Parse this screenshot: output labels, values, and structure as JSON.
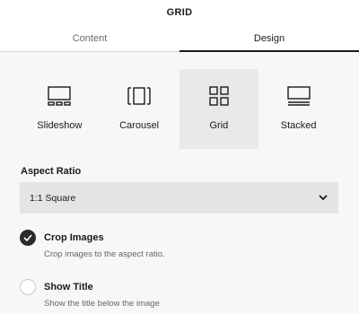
{
  "panel": {
    "title": "GRID"
  },
  "tabs": [
    {
      "label": "Content",
      "active": false
    },
    {
      "label": "Design",
      "active": true
    }
  ],
  "layouts": [
    {
      "label": "Slideshow",
      "icon": "slideshow-icon",
      "selected": false
    },
    {
      "label": "Carousel",
      "icon": "carousel-icon",
      "selected": false
    },
    {
      "label": "Grid",
      "icon": "grid-icon",
      "selected": true
    },
    {
      "label": "Stacked",
      "icon": "stacked-icon",
      "selected": false
    }
  ],
  "aspect_ratio": {
    "label": "Aspect Ratio",
    "value": "1:1 Square",
    "icon": "chevron-down-icon"
  },
  "options": {
    "crop_images": {
      "title": "Crop Images",
      "description": "Crop images to the aspect ratio.",
      "checked": true
    },
    "show_title": {
      "title": "Show Title",
      "description": "Show the title below the image",
      "checked": false
    }
  },
  "colors": {
    "background": "#f7f7f7",
    "selected_tile": "#e9e9e9",
    "select_bg": "#e4e4e4",
    "check_fill": "#2b2b2b"
  }
}
